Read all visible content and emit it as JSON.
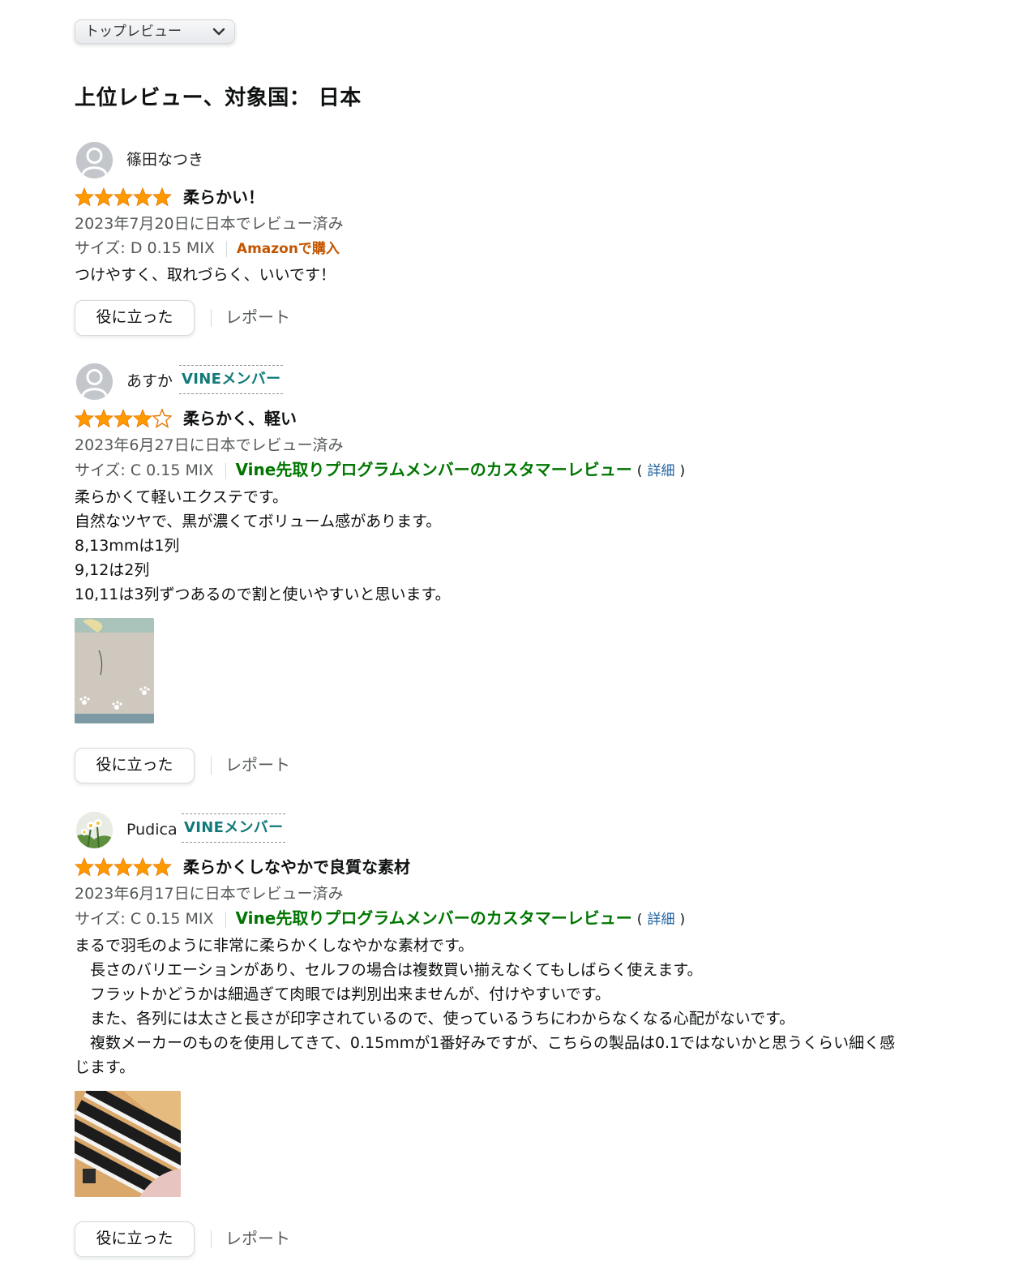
{
  "sort": {
    "selected": "トップレビュー"
  },
  "section_title": "上位レビュー、対象国： 日本",
  "colors": {
    "star": "#ff9900",
    "vine_badge": "#127a7a",
    "vine_note": "#007600",
    "verified": "#c45500",
    "link": "#2162a1"
  },
  "reviews": [
    {
      "name": "篠田なつき",
      "avatar": "default-avatar",
      "vine_badge": "",
      "rating": 5,
      "title": "柔らかい！",
      "date": "2023年7月20日に日本でレビュー済み",
      "size": "サイズ: D 0.15 MIX",
      "verified": "Amazonで購入",
      "body": "つけやすく、取れづらく、いいです！",
      "has_image": false,
      "helpful_label": "役に立った",
      "report_label": "レポート"
    },
    {
      "name": "あすか",
      "avatar": "default-avatar",
      "vine_badge": "VINEメンバー",
      "rating": 4,
      "title": "柔らかく、軽い",
      "date": "2023年6月27日に日本でレビュー済み",
      "size": "サイズ: C 0.15 MIX",
      "vine_note": "Vine先取りプログラムメンバーのカスタマーレビュー",
      "paren_open": "(",
      "detail": "詳細",
      "paren_close": ")",
      "body": "柔らかくて軽いエクステです。\n自然なツヤで、黒が濃くてボリューム感があります。\n8,13mmは1列\n9,12は2列\n10,11は3列ずつあるので割と使いやすいと思います。",
      "has_image": true,
      "helpful_label": "役に立った",
      "report_label": "レポート"
    },
    {
      "name": "Pudica",
      "avatar": "flower-photo-avatar",
      "vine_badge": "VINEメンバー",
      "rating": 5,
      "title": "柔らかくしなやかで良質な素材",
      "date": "2023年6月17日に日本でレビュー済み",
      "size": "サイズ: C 0.15 MIX",
      "vine_note": "Vine先取りプログラムメンバーのカスタマーレビュー",
      "paren_open": "(",
      "detail": "詳細",
      "paren_close": ")",
      "body": "まるで羽毛のように非常に柔らかくしなやかな素材です。\n　長さのバリエーションがあり、セルフの場合は複数買い揃えなくてもしばらく使えます。\n　フラットかどうかは細過ぎて肉眼では判別出来ませんが、付けやすいです。\n　また、各列には太さと長さが印字されているので、使っているうちにわからなくなる心配がないです。\n　複数メーカーのものを使用してきて、0.15mmが1番好みですが、こちらの製品は0.1ではないかと思うくらい細く感じます。",
      "has_image": true,
      "helpful_label": "役に立った",
      "report_label": "レポート"
    }
  ]
}
